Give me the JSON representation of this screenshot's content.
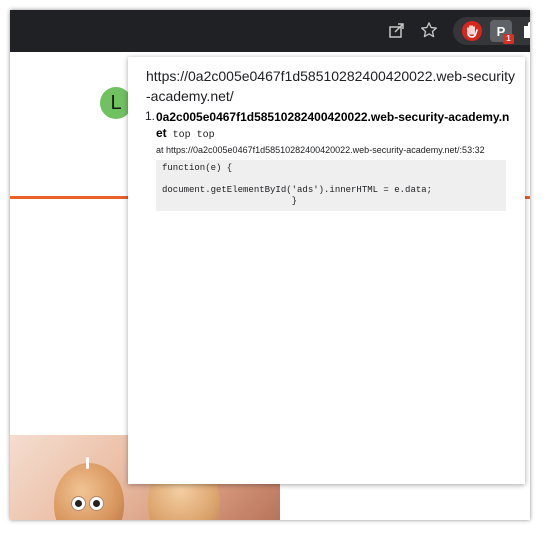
{
  "browser": {
    "extensions": {
      "badge_count": "1",
      "ext_letter": "P",
      "icons": [
        "share-icon",
        "star-icon",
        "ublock-icon",
        "extension-icon",
        "puzzle-icon"
      ]
    }
  },
  "page": {
    "avatar_letter": "L",
    "accent_color": "#e9602b"
  },
  "popup": {
    "url": "https://0a2c005e0467f1d58510282400420022.web-security-academy.net/",
    "messages": [
      {
        "index": "1.",
        "origin": "0a2c005e0467f1d58510282400420022.web-security-academy.net",
        "tags": "top top",
        "location": "at https://0a2c005e0467f1d58510282400420022.web-security-academy.net/:53:32",
        "code": "function(e) {\n\ndocument.getElementById('ads').innerHTML = e.data;\n                        }"
      }
    ]
  }
}
